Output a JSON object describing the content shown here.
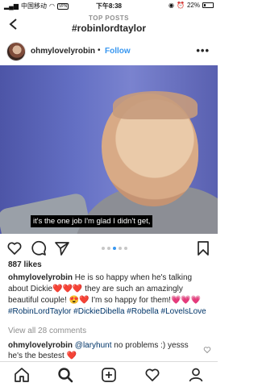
{
  "status_bar": {
    "carrier": "中国移动",
    "vpn": "VPN",
    "time": "下午8:38",
    "battery": "22%"
  },
  "nav": {
    "subtitle": "TOP POSTS",
    "title": "#robinlordtaylor"
  },
  "post": {
    "username": "ohmylovelyrobin",
    "separator": "•",
    "follow_label": "Follow",
    "more_label": "•••",
    "caption_overlay": "it's the one job I'm glad I didn't get,",
    "likes": "887 likes",
    "caption": {
      "username": "ohmylovelyrobin",
      "text_1": " He is so happy when he's talking about Dickie",
      "hearts_1": "❤️❤️❤️",
      "text_2": " they are such an amazingly beautiful couple! ",
      "emoji_1": "😍❤️",
      "text_3": " I'm so happy for them!",
      "hearts_2": "💗💗💗",
      "tags": " #RobinLordTaylor #DickieDibella #Robella #LovelsLove"
    },
    "view_all": "View all 28 comments",
    "comment": {
      "username": "ohmylovelyrobin",
      "mention": " @laryhunt",
      "text": " no problems :) yesss he's the bestest ",
      "heart": "❤️"
    }
  },
  "carousel": {
    "count": 5,
    "active": 2
  },
  "tabbar": {
    "items": [
      "home-icon",
      "search-icon",
      "add-icon",
      "heart-icon",
      "profile-icon"
    ]
  },
  "colors": {
    "accent": "#3897f0",
    "text": "#262626",
    "muted": "#8e8e8e",
    "hashtag": "#003569"
  }
}
